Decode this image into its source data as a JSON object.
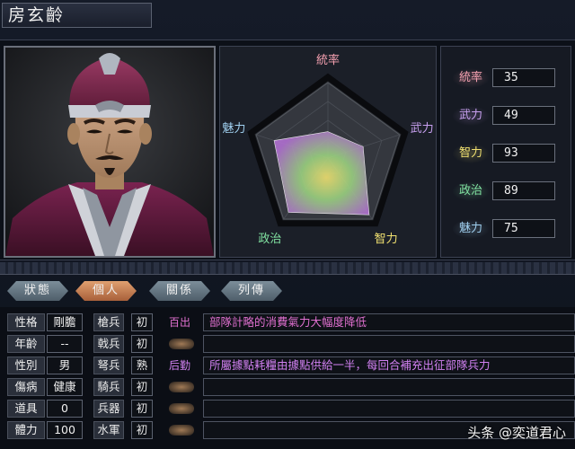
{
  "character": {
    "name": "房玄齡"
  },
  "radar": {
    "axes": [
      "統率",
      "武力",
      "智力",
      "政治",
      "魅力"
    ],
    "values": [
      35,
      49,
      93,
      89,
      75
    ],
    "max": 100,
    "axis_colors": [
      "#f4a0b0",
      "#c8a0f0",
      "#f0e070",
      "#80e0a0",
      "#a0d0f0"
    ]
  },
  "stats": [
    {
      "label": "統率",
      "value": "35",
      "color": "#f4a0b0"
    },
    {
      "label": "武力",
      "value": "49",
      "color": "#c8a0f0"
    },
    {
      "label": "智力",
      "value": "93",
      "color": "#f0e070"
    },
    {
      "label": "政治",
      "value": "89",
      "color": "#80e0a0"
    },
    {
      "label": "魅力",
      "value": "75",
      "color": "#a0d0f0"
    }
  ],
  "tabs": [
    {
      "label": "狀態"
    },
    {
      "label": "個人"
    },
    {
      "label": "關係"
    },
    {
      "label": "列傳"
    }
  ],
  "profile": [
    {
      "label": "性格",
      "value": "剛膽"
    },
    {
      "label": "年齡",
      "value": "--"
    },
    {
      "label": "性別",
      "value": "男"
    },
    {
      "label": "傷病",
      "value": "健康"
    },
    {
      "label": "道具",
      "value": "0"
    },
    {
      "label": "體力",
      "value": "100"
    }
  ],
  "units": [
    {
      "label": "槍兵",
      "grade": "初"
    },
    {
      "label": "戟兵",
      "grade": "初"
    },
    {
      "label": "弩兵",
      "grade": "熟"
    },
    {
      "label": "騎兵",
      "grade": "初"
    },
    {
      "label": "兵器",
      "grade": "初"
    },
    {
      "label": "水軍",
      "grade": "初"
    }
  ],
  "skills": [
    {
      "tag": "百出",
      "desc": "部隊計略的消費氣力大幅度降低",
      "color": "#e070d0"
    },
    {
      "tag": "",
      "desc": "",
      "color": ""
    },
    {
      "tag": "后勤",
      "desc": "所屬據點耗糧由據點供給一半，每回合補充出征部隊兵力",
      "color": "#d080f0"
    },
    {
      "tag": "",
      "desc": "",
      "color": ""
    },
    {
      "tag": "",
      "desc": "",
      "color": ""
    },
    {
      "tag": "",
      "desc": "",
      "color": ""
    }
  ],
  "watermark": "头条 @奕道君心"
}
